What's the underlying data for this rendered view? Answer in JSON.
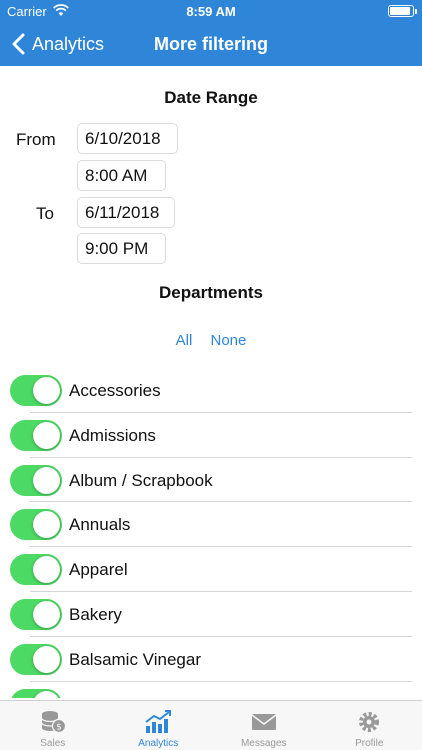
{
  "status_bar": {
    "carrier": "Carrier",
    "time": "8:59 AM"
  },
  "nav": {
    "back_label": "Analytics",
    "title": "More filtering"
  },
  "date_range": {
    "title": "Date Range",
    "from_label": "From",
    "from_date": "6/10/2018",
    "from_time": "8:00 AM",
    "to_label": "To",
    "to_date": "6/11/2018",
    "to_time": "9:00 PM"
  },
  "departments": {
    "title": "Departments",
    "all_label": "All",
    "none_label": "None",
    "items": [
      {
        "label": "Accessories",
        "on": true
      },
      {
        "label": "Admissions",
        "on": true
      },
      {
        "label": "Album / Scrapbook",
        "on": true
      },
      {
        "label": "Annuals",
        "on": true
      },
      {
        "label": "Apparel",
        "on": true
      },
      {
        "label": "Bakery",
        "on": true
      },
      {
        "label": "Balsamic Vinegar",
        "on": true
      }
    ]
  },
  "tabs": [
    {
      "label": "Sales",
      "icon": "coins-icon",
      "active": false
    },
    {
      "label": "Analytics",
      "icon": "chart-icon",
      "active": true
    },
    {
      "label": "Messages",
      "icon": "envelope-icon",
      "active": false
    },
    {
      "label": "Profile",
      "icon": "gear-icon",
      "active": false
    }
  ],
  "colors": {
    "accent": "#2f86d8",
    "toggle_on": "#4cd964",
    "tab_inactive": "#999999"
  }
}
